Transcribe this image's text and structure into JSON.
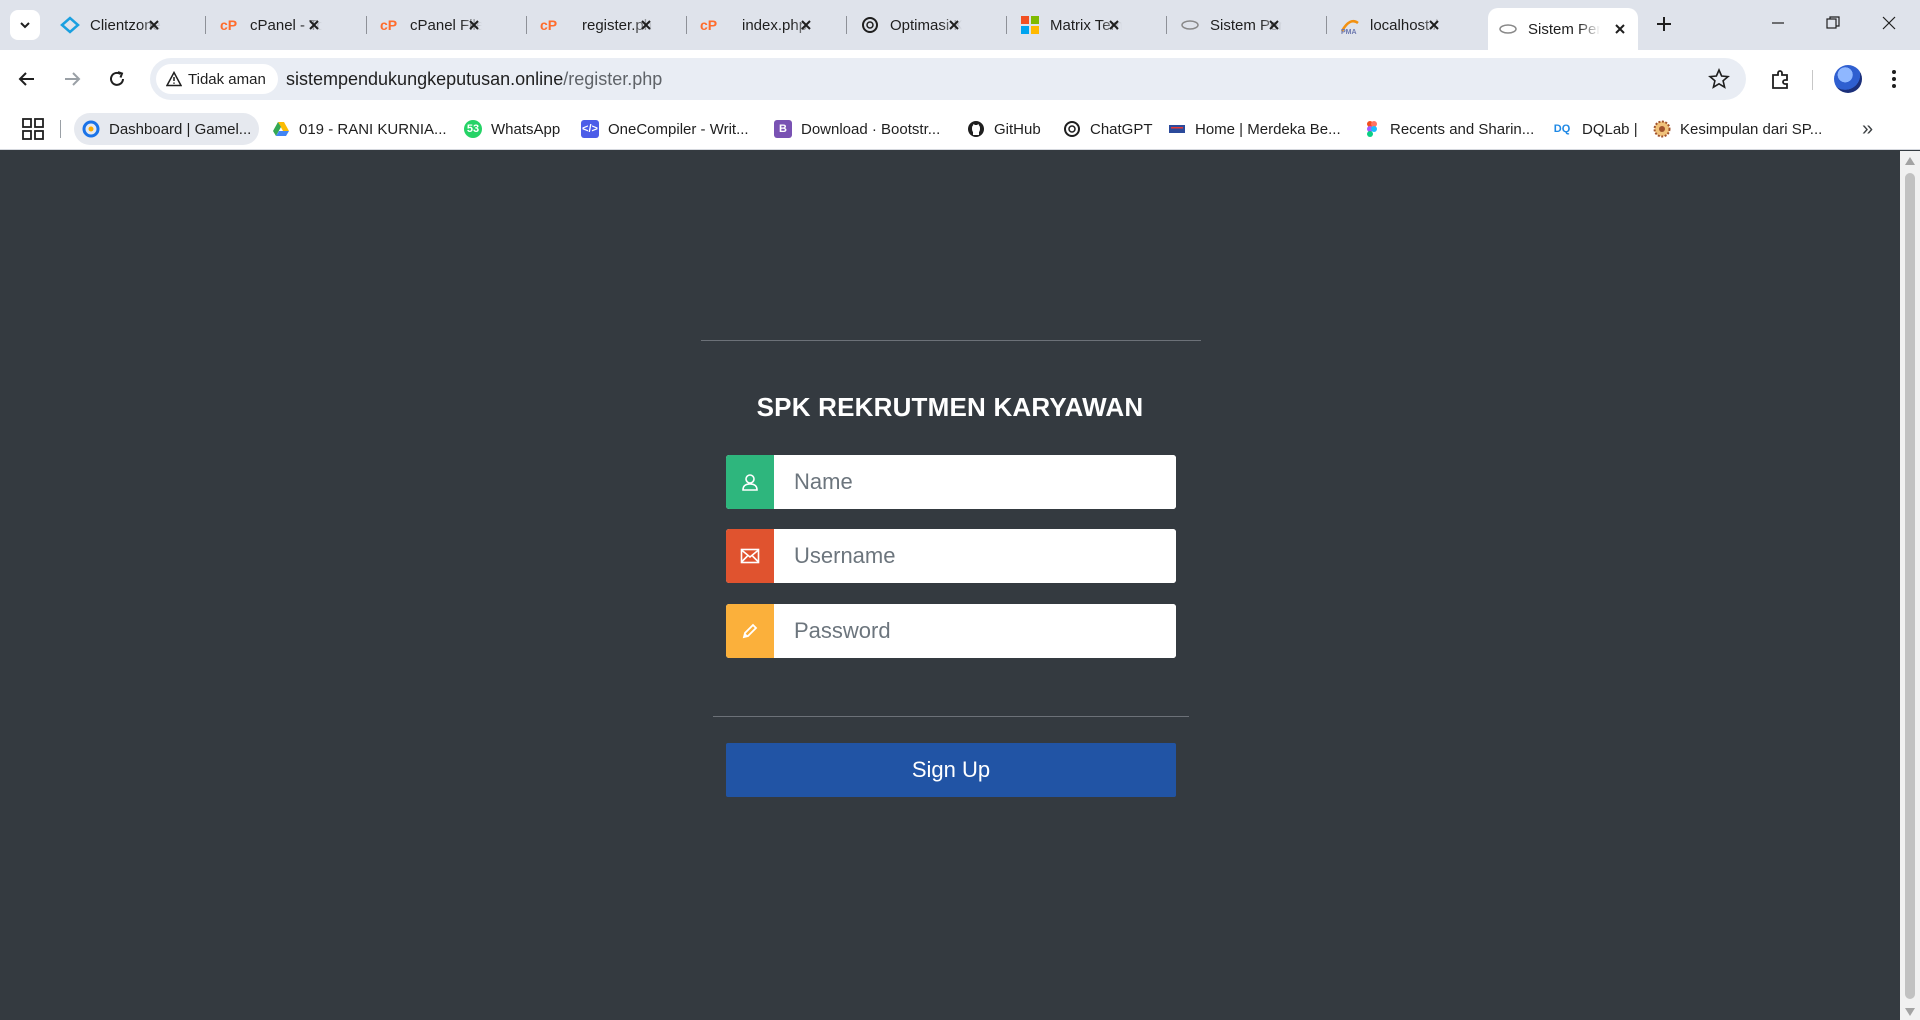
{
  "browser": {
    "tabs": [
      {
        "title": "Clientzone",
        "icon": "clientzone-icon",
        "color": "#1aa0e0"
      },
      {
        "title": "cPanel - To",
        "icon": "cpanel-icon",
        "color": "#ff6c2c"
      },
      {
        "title": "cPanel File",
        "icon": "cpanel-icon",
        "color": "#ff6c2c"
      },
      {
        "title": "register.ph",
        "icon": "cpanel-icon",
        "color": "#ff6c2c"
      },
      {
        "title": "index.php",
        "icon": "cpanel-icon",
        "color": "#ff6c2c"
      },
      {
        "title": "Optimasi K",
        "icon": "chatgpt-icon",
        "color": "#1f1f1f"
      },
      {
        "title": "Matrix Tem",
        "icon": "microsoft-icon",
        "color": "#f25022"
      },
      {
        "title": "Sistem Pen",
        "icon": "site-icon",
        "color": "#888888"
      },
      {
        "title": "localhost /",
        "icon": "phpmyadmin-icon",
        "color": "#f29111"
      },
      {
        "title": "Sistem Pen",
        "icon": "site-icon",
        "color": "#888888",
        "active": true
      }
    ],
    "address_bar": {
      "security_label": "Tidak aman",
      "domain": "sistempendukungkeputusan.online",
      "path": "/register.php"
    },
    "bookmarks": [
      {
        "label": "Dashboard | Gamel...",
        "icon": "gamelab-icon",
        "color": "#1a73e8"
      },
      {
        "label": "019 - RANI KURNIA...",
        "icon": "google-drive-icon",
        "color": "#34a853"
      },
      {
        "label": "WhatsApp",
        "icon": "whatsapp-icon",
        "color": "#25d366",
        "badge": "53"
      },
      {
        "label": "OneCompiler - Writ...",
        "icon": "onecompiler-icon",
        "color": "#4c5de8"
      },
      {
        "label": "Download · Bootstr...",
        "icon": "bootstrap-icon",
        "color": "#7952b3"
      },
      {
        "label": "GitHub",
        "icon": "github-icon",
        "color": "#1f1f1f"
      },
      {
        "label": "ChatGPT",
        "icon": "chatgpt-icon",
        "color": "#1f1f1f"
      },
      {
        "label": "Home | Merdeka Be...",
        "icon": "merdeka-icon",
        "color": "#2b4a9b"
      },
      {
        "label": "Recents and Sharin...",
        "icon": "figma-icon",
        "color": "#f24e1e"
      },
      {
        "label": "DQLab |",
        "icon": "dqlab-icon",
        "color": "#1e88e5"
      },
      {
        "label": "Kesimpulan dari SP...",
        "icon": "seal-icon",
        "color": "#a0522d"
      }
    ]
  },
  "form": {
    "title": "SPK REKRUTMEN KARYAWAN",
    "fields": [
      {
        "placeholder": "Name",
        "icon": "user-icon",
        "color": "#2eb67d"
      },
      {
        "placeholder": "Username",
        "icon": "envelope-icon",
        "color": "#e0532f"
      },
      {
        "placeholder": "Password",
        "icon": "pencil-icon",
        "color": "#fbb03b"
      }
    ],
    "submit_label": "Sign Up",
    "submit_color": "#2154a5"
  }
}
